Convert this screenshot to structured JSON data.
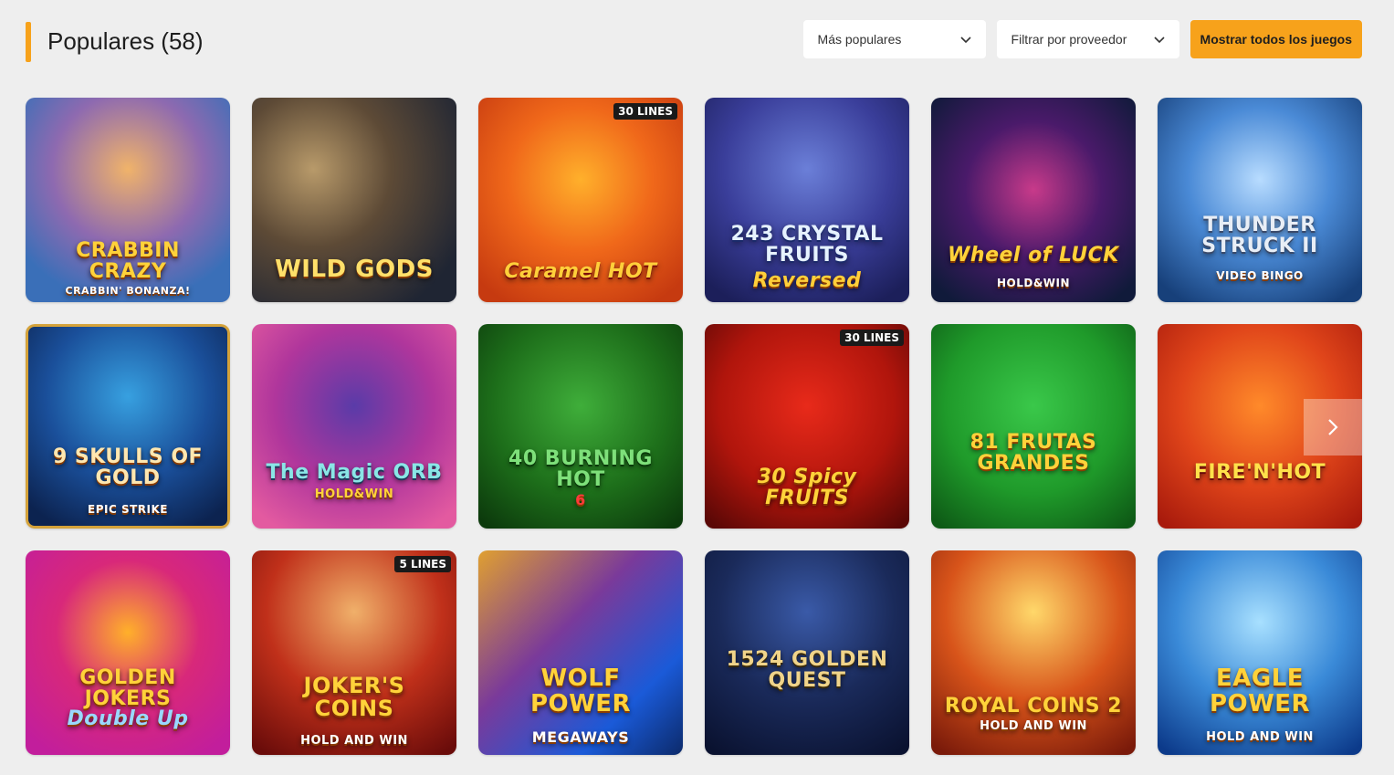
{
  "header": {
    "title": "Populares (58)",
    "sort_select": "Más populares",
    "provider_select": "Filtrar por proveedor",
    "show_all_label": "Mostrar todos los juegos"
  },
  "colors": {
    "accent": "#f7a21b",
    "background": "#eeeeee"
  },
  "games": [
    {
      "title": "CRABBIN CRAZY",
      "subtitle": "CRABBIN' BONANZA!",
      "badge": ""
    },
    {
      "title": "WILD GODS",
      "subtitle": "",
      "badge": ""
    },
    {
      "title": "Caramel HOT",
      "subtitle": "",
      "badge": "30 LINES"
    },
    {
      "title": "243 CRYSTAL FRUITS",
      "subtitle": "Reversed",
      "badge": ""
    },
    {
      "title": "Wheel of LUCK",
      "subtitle": "HOLD&WIN",
      "badge": ""
    },
    {
      "title": "THUNDER STRUCK II",
      "subtitle": "VIDEO BINGO",
      "badge": ""
    },
    {
      "title": "9 SKULLS OF GOLD",
      "subtitle": "EPIC STRIKE",
      "badge": ""
    },
    {
      "title": "The Magic ORB",
      "subtitle": "HOLD&WIN",
      "badge": ""
    },
    {
      "title": "40 BURNING HOT",
      "subtitle": "6",
      "badge": ""
    },
    {
      "title": "30 Spicy FRUITS",
      "subtitle": "",
      "badge": "30 LINES"
    },
    {
      "title": "81 FRUTAS GRANDES",
      "subtitle": "",
      "badge": ""
    },
    {
      "title": "FIRE'N'HOT",
      "subtitle": "",
      "badge": ""
    },
    {
      "title": "GOLDEN JOKERS",
      "subtitle": "Double Up",
      "badge": ""
    },
    {
      "title": "JOKER'S COINS",
      "subtitle": "HOLD AND WIN",
      "badge": "5 LINES"
    },
    {
      "title": "WOLF POWER",
      "subtitle": "MEGAWAYS",
      "badge": ""
    },
    {
      "title": "1524 GOLDEN QUEST",
      "subtitle": "",
      "badge": ""
    },
    {
      "title": "ROYAL COINS 2",
      "subtitle": "HOLD AND WIN",
      "badge": ""
    },
    {
      "title": "EAGLE POWER",
      "subtitle": "HOLD AND WIN",
      "badge": ""
    }
  ]
}
